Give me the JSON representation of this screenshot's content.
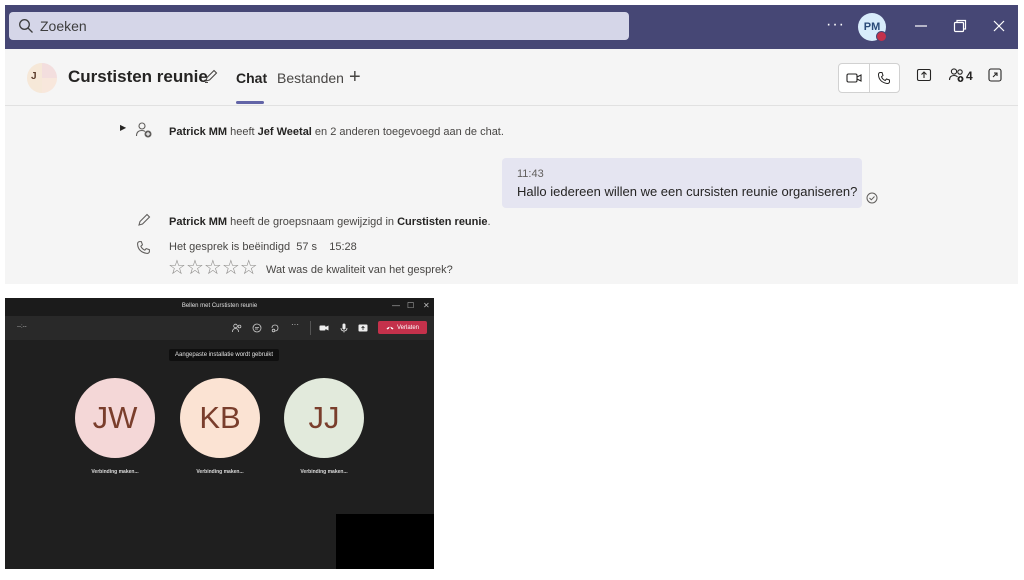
{
  "search": {
    "placeholder": "Zoeken"
  },
  "topbar": {
    "more": "···",
    "avatar_initials": "PM",
    "avatar_status_color": "#c4314b"
  },
  "chat": {
    "group_avatar_initial": "J",
    "title": "Curstisten reunie",
    "tabs": [
      "Chat",
      "Bestanden"
    ],
    "active_tab": "Chat",
    "participants_count": "4"
  },
  "messages": {
    "added": {
      "actor": "Patrick MM",
      "verb": " heeft ",
      "target": "Jef Weetal",
      "rest": " en 2 anderen toegevoegd aan de chat."
    },
    "bubble": {
      "time": "11:43",
      "text": "Hallo iedereen willen we een cursisten reunie organiseren?"
    },
    "renamed": {
      "actor": "Patrick MM",
      "rest": " heeft de groepsnaam gewijzigd in ",
      "name": "Curstisten reunie",
      "end": "."
    },
    "call_ended": {
      "text": "Het gesprek is beëindigd",
      "duration": "57 s",
      "time": "15:28"
    },
    "rating": {
      "stars": 5,
      "question": "Wat was de kwaliteit van het gesprek?"
    }
  },
  "call_window": {
    "title": "Bellen met Curstisten reunie",
    "timer": "--:--",
    "leave_label": "Verlaten",
    "tooltip": "Aangepaste installatie wordt gebruikt",
    "participants": [
      {
        "initials": "JW",
        "status": "Verbinding maken...",
        "bg": "#f4d7d7"
      },
      {
        "initials": "KB",
        "status": "Verbinding maken...",
        "bg": "#fbe3d3"
      },
      {
        "initials": "JJ",
        "status": "Verbinding maken...",
        "bg": "#e2eadc"
      }
    ]
  },
  "colors": {
    "brand": "#464775",
    "accent": "#6264a7",
    "leave": "#c4314b"
  }
}
